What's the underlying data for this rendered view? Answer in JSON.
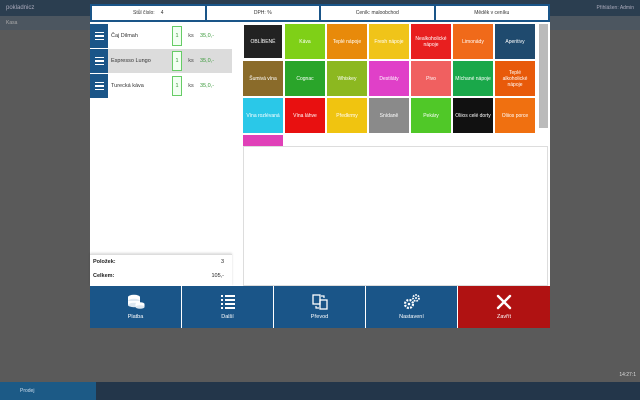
{
  "background": {
    "logo": "pokladnicz",
    "user": "Přihlášen: Admin",
    "subbar_item": "Kasa",
    "bottom_item": "Prodej",
    "time": "14:27:1"
  },
  "info_bar": [
    {
      "label": "Stůl číslo:",
      "value": "4"
    },
    {
      "label": "DPH: %",
      "value": ""
    },
    {
      "label": "Ceník: maloobchod",
      "value": ""
    },
    {
      "label": "Měděk v ceníku",
      "value": ""
    }
  ],
  "order_items": [
    {
      "name": "Čaj Dilmah",
      "qty": "1",
      "unit": "ks",
      "price": "35,0,-"
    },
    {
      "name": "Espresso Lungo",
      "qty": "1",
      "unit": "ks",
      "price": "35,0,-"
    },
    {
      "name": "Turecká káva",
      "qty": "1",
      "unit": "ks",
      "price": "35,0,-"
    }
  ],
  "totals": {
    "items_label": "Položek:",
    "items_value": "3",
    "total_label": "Celkem:",
    "total_value": "105,-"
  },
  "categories": [
    {
      "label": "OBLÍBENÉ",
      "color": "#222222"
    },
    {
      "label": "Káva",
      "color": "#7fd017"
    },
    {
      "label": "Teplé nápoje",
      "color": "#e88a0a"
    },
    {
      "label": "Fresh nápoje",
      "color": "#f0c419"
    },
    {
      "label": "Nealkoholické nápoje",
      "color": "#e81f1f"
    },
    {
      "label": "Limonády",
      "color": "#f06a1a"
    },
    {
      "label": "Aperitivy",
      "color": "#1f4a6e"
    },
    {
      "label": "Šumivá vína",
      "color": "#8a6b2a"
    },
    {
      "label": "Cognac",
      "color": "#2aa52a"
    },
    {
      "label": "Whiskey",
      "color": "#8cb820"
    },
    {
      "label": "Destiláty",
      "color": "#e040c8"
    },
    {
      "label": "Pivo",
      "color": "#f06060"
    },
    {
      "label": "Míchané nápoje",
      "color": "#1aa84a"
    },
    {
      "label": "Teplé alkoholické nápoje",
      "color": "#e85a0a"
    },
    {
      "label": "Vína rozlévaná",
      "color": "#2ac8e8"
    },
    {
      "label": "Vína láhve",
      "color": "#e81010"
    },
    {
      "label": "Předkrmy",
      "color": "#f0c410"
    },
    {
      "label": "Snídaně",
      "color": "#8a8a8a"
    },
    {
      "label": "Pekáry",
      "color": "#50c828"
    },
    {
      "label": "Oliios celé dorty",
      "color": "#111111"
    },
    {
      "label": "Oliios porce",
      "color": "#f07010"
    },
    {
      "label": "",
      "color": "#e040b8"
    }
  ],
  "actions": [
    {
      "label": "Platba",
      "icon": "coins-icon"
    },
    {
      "label": "Další",
      "icon": "list-icon"
    },
    {
      "label": "Převod",
      "icon": "transfer-icon"
    },
    {
      "label": "Nastavení",
      "icon": "gears-icon"
    },
    {
      "label": "Zavřít",
      "icon": "close-icon"
    }
  ]
}
